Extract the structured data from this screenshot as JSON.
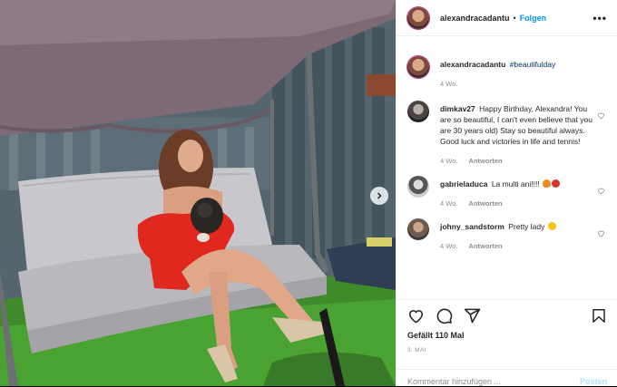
{
  "header": {
    "username": "alexandracadantu",
    "separator": "•",
    "follow_label": "Folgen",
    "more_label": "•••"
  },
  "caption": {
    "username": "alexandracadantu",
    "text": "",
    "hashtag": "#beautifulday",
    "age": "4 Wo."
  },
  "comments": [
    {
      "username": "dimkav27",
      "text": "Happy Birthday, Alexandra! You are so beautiful, I can't even believe that you are 30 years old) Stay so beautiful always. Good luck and victories in life and tennis!",
      "age": "4 Wo.",
      "reply_label": "Antworten",
      "emojis": []
    },
    {
      "username": "gabrieladuca",
      "text": "La multi ani!!!!",
      "age": "4 Wo.",
      "reply_label": "Antworten",
      "emojis": [
        "fire",
        "tennis-ball"
      ]
    },
    {
      "username": "johny_sandstorm",
      "text": "Pretty lady",
      "age": "4 Wo.",
      "reply_label": "Antworten",
      "emojis": [
        "grin"
      ]
    }
  ],
  "actions": {
    "icons": [
      "heart-icon",
      "comment-icon",
      "share-icon",
      "bookmark-icon"
    ]
  },
  "likes_text": "Gefällt 110 Mal",
  "post_date": "3. MAI",
  "comment_box": {
    "placeholder": "Kommentar hinzufügen ...",
    "post_label": "Posten"
  },
  "colors": {
    "link_blue": "#0095f6",
    "hashtag_blue": "#00376b",
    "muted_gray": "#8e8e8e",
    "post_disabled": "#b2dffc",
    "dress_red": "#e0281f"
  }
}
